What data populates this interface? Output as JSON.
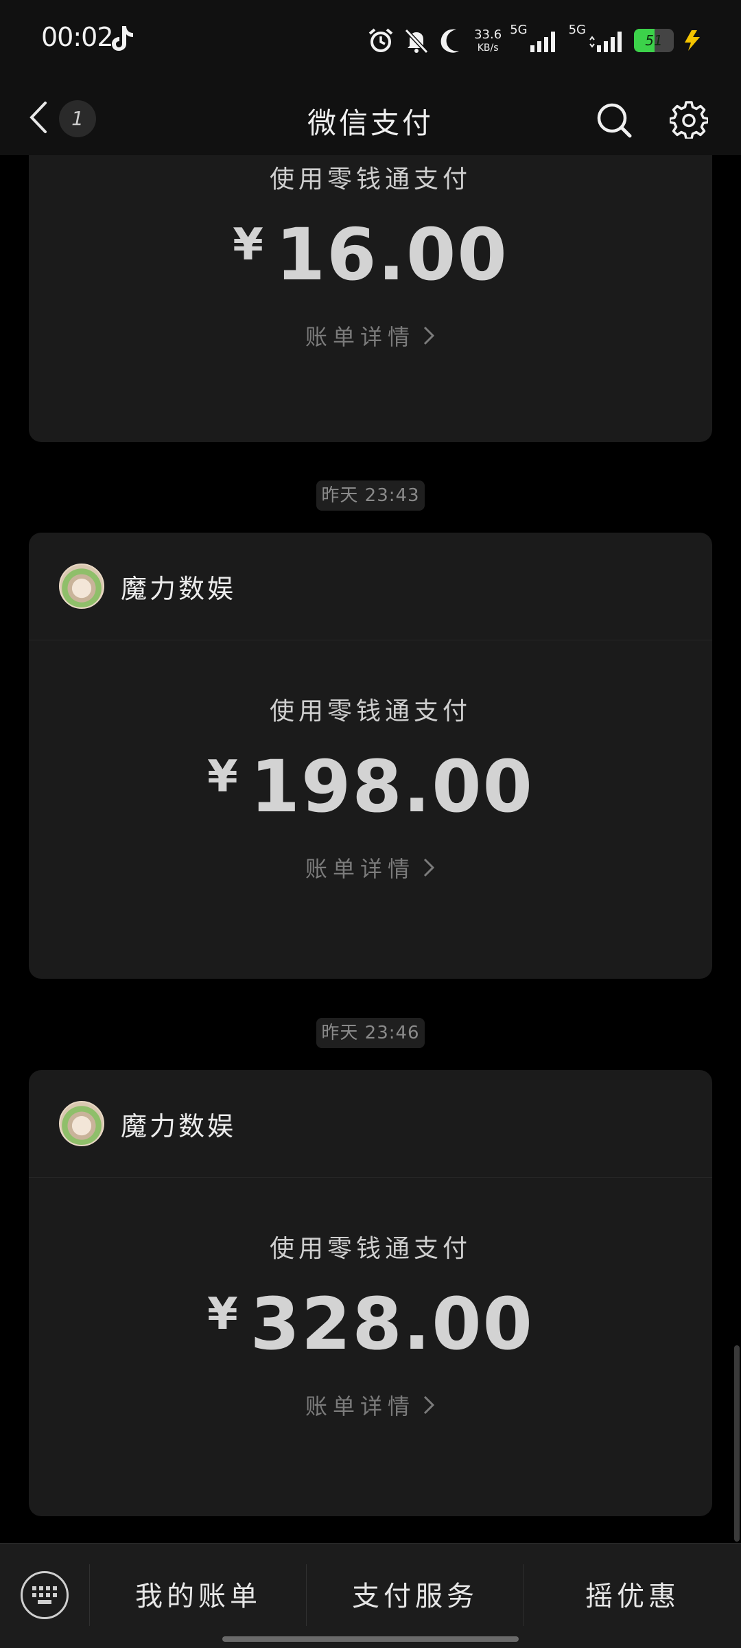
{
  "status_bar": {
    "time": "00:02",
    "net_speed_value": "33.6",
    "net_speed_unit": "KB/s",
    "sim1_label": "5G",
    "sim2_label": "5G",
    "battery_level": "51",
    "icons": [
      "tiktok-icon",
      "alarm-icon",
      "mute-bell-icon",
      "moon-icon",
      "signal-icon",
      "battery-icon",
      "charging-icon"
    ]
  },
  "header": {
    "title": "微信支付",
    "unread_count": "1"
  },
  "messages": [
    {
      "pay_label": "使用零钱通支付",
      "currency": "¥",
      "amount": "16.00",
      "detail_label": "账单详情"
    },
    {
      "timestamp": "昨天 23:43",
      "merchant": "魔力数娱",
      "pay_label": "使用零钱通支付",
      "currency": "¥",
      "amount": "198.00",
      "detail_label": "账单详情"
    },
    {
      "timestamp": "昨天 23:46",
      "merchant": "魔力数娱",
      "pay_label": "使用零钱通支付",
      "currency": "¥",
      "amount": "328.00",
      "detail_label": "账单详情"
    }
  ],
  "bottom_menu": {
    "items": [
      "我的账单",
      "支付服务",
      "摇优惠"
    ]
  },
  "colors": {
    "background": "#000000",
    "card": "#1b1b1b",
    "battery_green": "#3cd24a",
    "charging_yellow": "#f5c400"
  }
}
